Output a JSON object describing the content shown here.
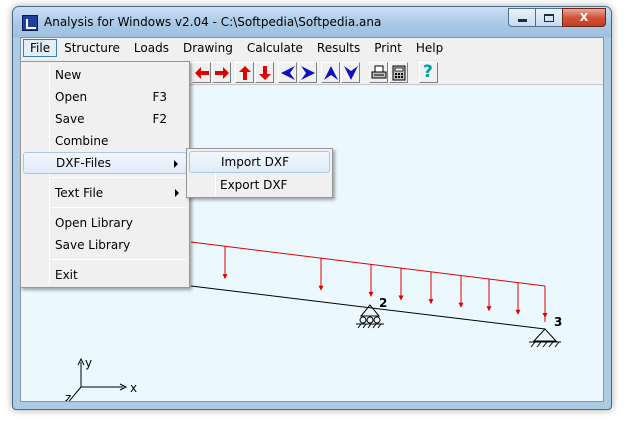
{
  "window": {
    "title": "Analysis for Windows v2.04 - C:\\Softpedia\\Softpedia.ana",
    "min_icon": "minimize-icon",
    "max_icon": "maximize-icon",
    "close_icon": "close-icon",
    "close_glyph": "X"
  },
  "menubar": {
    "items": [
      "File",
      "Structure",
      "Loads",
      "Drawing",
      "Calculate",
      "Results",
      "Print",
      "Help"
    ],
    "active": "File"
  },
  "toolbar": {
    "buttons": [
      {
        "icon": "arrow-left-icon",
        "color": "#e00000"
      },
      {
        "icon": "arrow-right-icon",
        "color": "#e00000"
      },
      {
        "icon": "arrow-up-icon",
        "color": "#e00000"
      },
      {
        "icon": "arrow-down-icon",
        "color": "#e00000"
      },
      {
        "icon": "triangle-left-icon",
        "color": "#1010c0"
      },
      {
        "icon": "triangle-right-icon",
        "color": "#1010c0"
      },
      {
        "icon": "triangle-up-icon",
        "color": "#1010c0"
      },
      {
        "icon": "triangle-down-icon",
        "color": "#1010c0"
      },
      {
        "icon": "printer-icon",
        "color": "#000000"
      },
      {
        "icon": "calculator-icon",
        "color": "#000000"
      },
      {
        "icon": "help-icon",
        "color": "#00a0a0"
      }
    ],
    "help_glyph": "?"
  },
  "file_menu": {
    "items": [
      {
        "label": "New",
        "shortcut": ""
      },
      {
        "label": "Open",
        "shortcut": "F3"
      },
      {
        "label": "Save",
        "shortcut": "F2"
      },
      {
        "label": "Combine",
        "shortcut": ""
      },
      {
        "label": "DXF-Files",
        "shortcut": "",
        "submenu": true
      },
      {
        "label": "Text File",
        "shortcut": "",
        "submenu": true
      },
      {
        "label": "Open Library",
        "shortcut": ""
      },
      {
        "label": "Save Library",
        "shortcut": ""
      },
      {
        "label": "Exit",
        "shortcut": ""
      }
    ],
    "highlighted": "DXF-Files"
  },
  "dxf_submenu": {
    "items": [
      "Import DXF",
      "Export DXF"
    ],
    "highlighted": "Import DXF"
  },
  "drawing": {
    "node_labels": [
      "2",
      "3"
    ],
    "axis_labels": {
      "y": "y",
      "x": "x",
      "z": "z"
    },
    "load_color": "#e00000",
    "beam_color": "#000000"
  }
}
